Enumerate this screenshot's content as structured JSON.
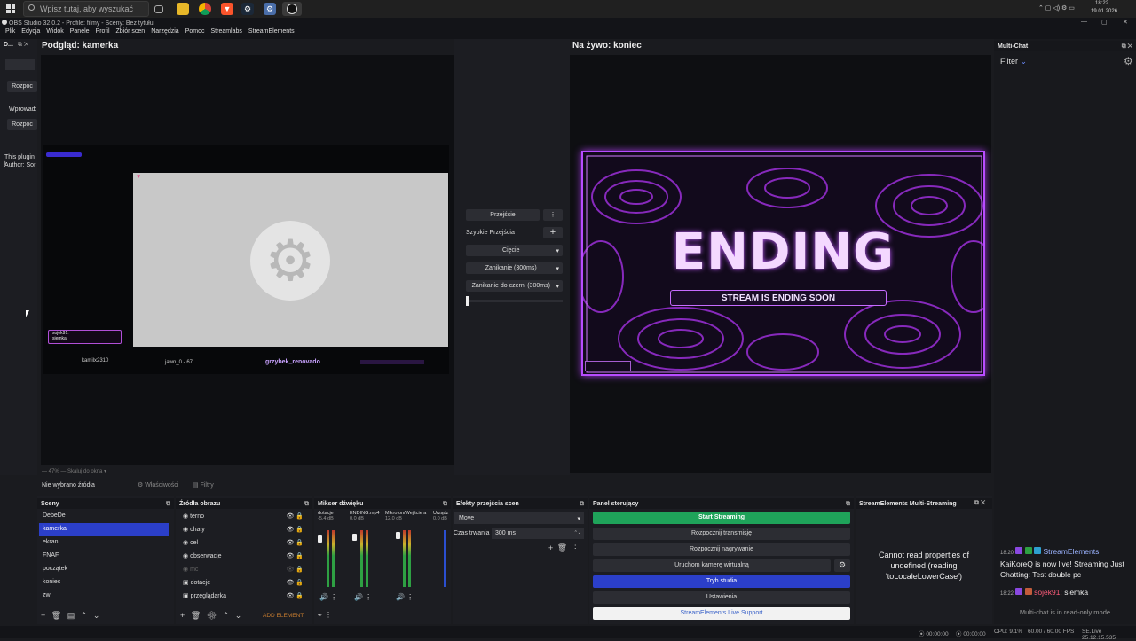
{
  "taskbar": {
    "search_placeholder": "Wpisz tutaj, aby wyszukać",
    "time": "18:22",
    "date": "19.01.2026"
  },
  "window": {
    "title": "OBS Studio 32.0.2 - Profile: filmy - Sceny: Bez tytułu"
  },
  "menu": [
    "Plik",
    "Edycja",
    "Widok",
    "Panele",
    "Profil",
    "Zbiór scen",
    "Narzędzia",
    "Pomoc",
    "Streamlabs",
    "StreamElements"
  ],
  "left_dock": {
    "title": "D...",
    "btn1": "Rozpoc",
    "label": "Wprowad:",
    "btn2": "Rozpoc",
    "plugin": "This plugin i",
    "author": "Author: Sor"
  },
  "preview": {
    "title": "Podgląd: kamerka",
    "names": [
      "kamilx2310",
      "jawn_0 - 67",
      "grzybek_renovado"
    ],
    "chat_user": "sojek91:",
    "chat_msg": "siemka",
    "zoom": "47%",
    "scale": "Skaluj do okna"
  },
  "live": {
    "title": "Na żywo: koniec",
    "ending": "ENDING",
    "ending_sub": "STREAM IS ENDING SOON"
  },
  "transition": {
    "button": "Przejście",
    "quick_label": "Szybkie Przejścia",
    "items": [
      "Cięcie",
      "Zanikanie (300ms)",
      "Zanikanie do czerni (300ms)"
    ]
  },
  "multichat": {
    "title": "Multi-Chat",
    "filter": "Filter",
    "messages": [
      {
        "time": "18:20",
        "user": "StreamElements:",
        "text": "KaiKoreQ is now live! Streaming Just Chatting: Test double pc"
      },
      {
        "time": "18:22",
        "user": "sojek91:",
        "text": "siemka"
      }
    ],
    "footer": "Multi-chat is in read-only mode"
  },
  "sourcebar": {
    "none": "Nie wybrano źródła",
    "props": "Właściwości",
    "filters": "Filtry"
  },
  "scenes": {
    "title": "Sceny",
    "items": [
      "DebeDe",
      "kamerka",
      "ekran",
      "FNAF",
      "początek",
      "koniec",
      "zw"
    ],
    "selected": 1
  },
  "sources": {
    "title": "Źródła obrazu",
    "items": [
      "terno",
      "chaty",
      "cel",
      "obserwacje",
      "mc",
      "dotacje",
      "przeglądarka"
    ],
    "add_element": "ADD ELEMENT"
  },
  "mixer": {
    "title": "Mikser dźwięku",
    "channels": [
      {
        "name": "dotacje",
        "db": "-5.4 dB"
      },
      {
        "name": "ENDING.mp4",
        "db": "0.0 dB"
      },
      {
        "name": "Mikrofon/Wejście a",
        "db": "12.0 dB"
      },
      {
        "name": "Urządz",
        "db": "0.0 dB"
      }
    ]
  },
  "effects": {
    "title": "Efekty przejścia scen",
    "transition": "Move",
    "duration_label": "Czas trwania",
    "duration": "300 ms"
  },
  "controls": {
    "title": "Panel sterujący",
    "start": "Start Streaming",
    "transmit": "Rozpocznij transmisję",
    "record": "Rozpocznij nagrywanie",
    "vcam": "Uruchom kamerę wirtualną",
    "studio": "Tryb studia",
    "settings": "Ustawienia",
    "support": "StreamElements Live Support"
  },
  "semulti": {
    "title": "StreamElements Multi-Streaming",
    "error": "Cannot read properties of undefined (reading 'toLocaleLowerCase')"
  },
  "status": {
    "t1": "00:00:00",
    "t2": "00:00:00",
    "cpu": "CPU: 9.1%",
    "fps": "60.00 / 60.00 FPS",
    "se": "SE.Live 25.12.15.535"
  }
}
